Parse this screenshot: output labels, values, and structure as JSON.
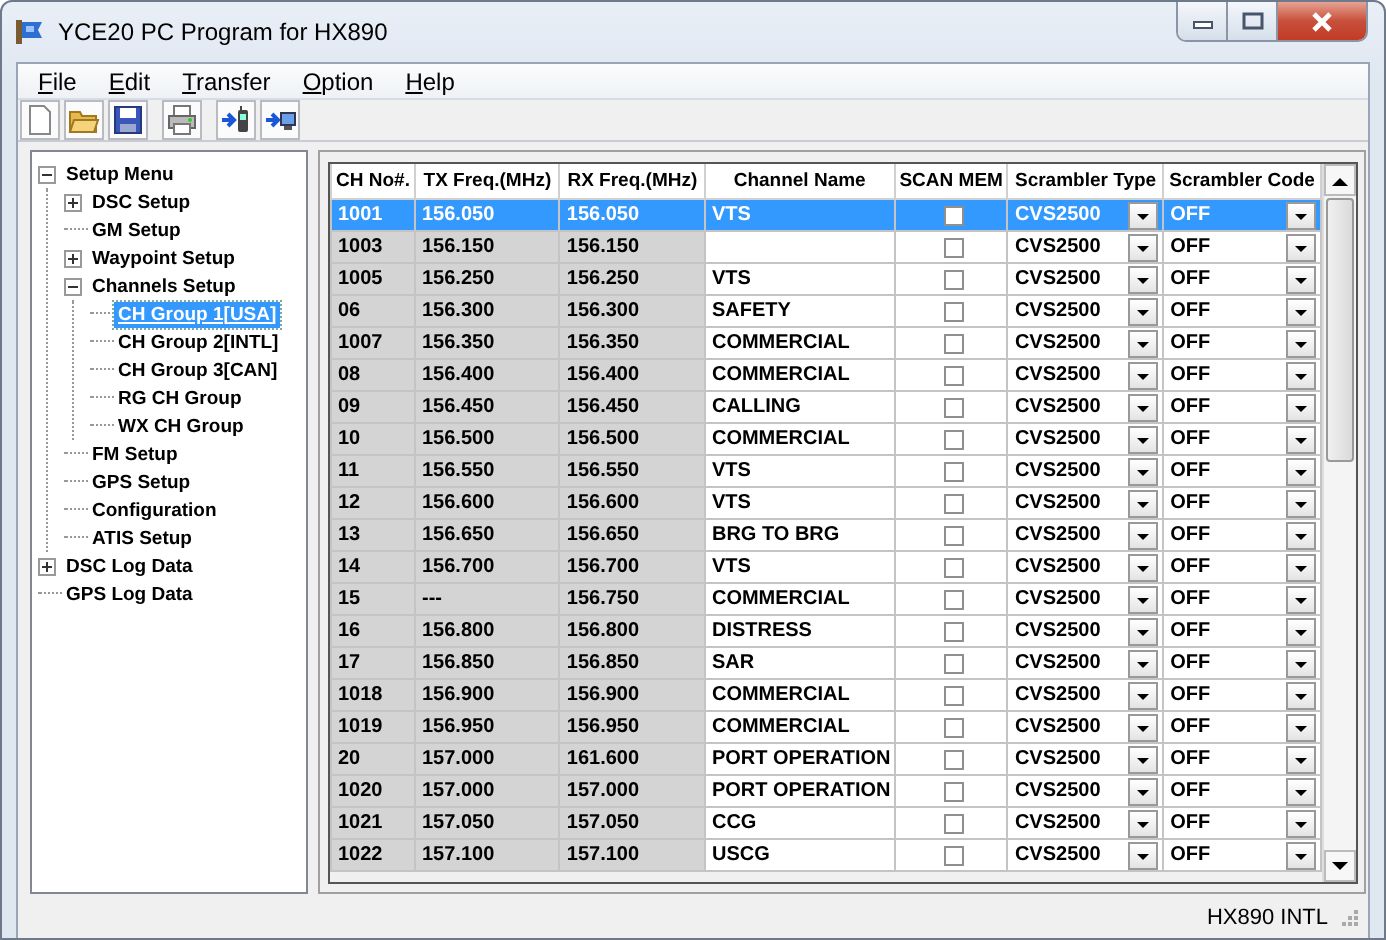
{
  "window": {
    "title": "YCE20 PC Program for HX890"
  },
  "menu": [
    {
      "label": "File"
    },
    {
      "label": "Edit"
    },
    {
      "label": "Transfer"
    },
    {
      "label": "Option"
    },
    {
      "label": "Help"
    }
  ],
  "tree": [
    {
      "label": "Setup Menu",
      "expanded": true,
      "selected": false,
      "children": [
        {
          "label": "DSC Setup",
          "expanded": false,
          "selected": false
        },
        {
          "label": "GM Setup",
          "selected": false
        },
        {
          "label": "Waypoint Setup",
          "expanded": false,
          "selected": false
        },
        {
          "label": "Channels Setup",
          "expanded": true,
          "selected": false,
          "children": [
            {
              "label": "CH Group 1[USA]",
              "selected": true
            },
            {
              "label": "CH Group 2[INTL]",
              "selected": false
            },
            {
              "label": "CH Group 3[CAN]",
              "selected": false
            },
            {
              "label": "RG CH Group",
              "selected": false
            },
            {
              "label": "WX CH Group",
              "selected": false
            }
          ]
        },
        {
          "label": "FM Setup",
          "selected": false
        },
        {
          "label": "GPS Setup",
          "selected": false
        },
        {
          "label": "Configuration",
          "selected": false
        },
        {
          "label": "ATIS Setup",
          "selected": false
        }
      ]
    },
    {
      "label": "DSC Log Data",
      "expanded": false,
      "selected": false
    },
    {
      "label": "GPS Log Data",
      "selected": false
    }
  ],
  "table": {
    "columns": [
      {
        "label": "CH No#.",
        "kind": "readonly"
      },
      {
        "label": "TX Freq.(MHz)",
        "kind": "readonly"
      },
      {
        "label": "RX Freq.(MHz)",
        "kind": "readonly"
      },
      {
        "label": "Channel Name",
        "kind": "text"
      },
      {
        "label": "SCAN MEM",
        "kind": "check"
      },
      {
        "label": "Scrambler Type",
        "kind": "dropdown"
      },
      {
        "label": "Scrambler Code",
        "kind": "dropdown"
      }
    ],
    "rows": [
      {
        "ch": "1001",
        "tx": "156.050",
        "rx": "156.050",
        "name": "VTS",
        "scan": false,
        "type": "CVS2500",
        "code": "OFF",
        "selected": true
      },
      {
        "ch": "1003",
        "tx": "156.150",
        "rx": "156.150",
        "scan": false,
        "type": "CVS2500",
        "code": "OFF",
        "selected": false
      },
      {
        "ch": "1005",
        "tx": "156.250",
        "rx": "156.250",
        "name": "VTS",
        "scan": false,
        "type": "CVS2500",
        "code": "OFF",
        "selected": false
      },
      {
        "ch": "06",
        "tx": "156.300",
        "rx": "156.300",
        "name": "SAFETY",
        "scan": false,
        "type": "CVS2500",
        "code": "OFF",
        "selected": false
      },
      {
        "ch": "1007",
        "tx": "156.350",
        "rx": "156.350",
        "name": "COMMERCIAL",
        "scan": false,
        "type": "CVS2500",
        "code": "OFF",
        "selected": false
      },
      {
        "ch": "08",
        "tx": "156.400",
        "rx": "156.400",
        "name": "COMMERCIAL",
        "scan": false,
        "type": "CVS2500",
        "code": "OFF",
        "selected": false
      },
      {
        "ch": "09",
        "tx": "156.450",
        "rx": "156.450",
        "name": "CALLING",
        "scan": false,
        "type": "CVS2500",
        "code": "OFF",
        "selected": false
      },
      {
        "ch": "10",
        "tx": "156.500",
        "rx": "156.500",
        "name": "COMMERCIAL",
        "scan": false,
        "type": "CVS2500",
        "code": "OFF",
        "selected": false
      },
      {
        "ch": "11",
        "tx": "156.550",
        "rx": "156.550",
        "name": "VTS",
        "scan": false,
        "type": "CVS2500",
        "code": "OFF",
        "selected": false
      },
      {
        "ch": "12",
        "tx": "156.600",
        "rx": "156.600",
        "name": "VTS",
        "scan": false,
        "type": "CVS2500",
        "code": "OFF",
        "selected": false
      },
      {
        "ch": "13",
        "tx": "156.650",
        "rx": "156.650",
        "name": "BRG TO BRG",
        "scan": false,
        "type": "CVS2500",
        "code": "OFF",
        "selected": false
      },
      {
        "ch": "14",
        "tx": "156.700",
        "rx": "156.700",
        "name": "VTS",
        "scan": false,
        "type": "CVS2500",
        "code": "OFF",
        "selected": false
      },
      {
        "ch": "15",
        "tx": "---",
        "rx": "156.750",
        "name": "COMMERCIAL",
        "scan": false,
        "type": "CVS2500",
        "code": "OFF",
        "selected": false
      },
      {
        "ch": "16",
        "tx": "156.800",
        "rx": "156.800",
        "name": "DISTRESS",
        "scan": false,
        "type": "CVS2500",
        "code": "OFF",
        "selected": false
      },
      {
        "ch": "17",
        "tx": "156.850",
        "rx": "156.850",
        "name": "SAR",
        "scan": false,
        "type": "CVS2500",
        "code": "OFF",
        "selected": false
      },
      {
        "ch": "1018",
        "tx": "156.900",
        "rx": "156.900",
        "name": "COMMERCIAL",
        "scan": false,
        "type": "CVS2500",
        "code": "OFF",
        "selected": false
      },
      {
        "ch": "1019",
        "tx": "156.950",
        "rx": "156.950",
        "name": "COMMERCIAL",
        "scan": false,
        "type": "CVS2500",
        "code": "OFF",
        "selected": false
      },
      {
        "ch": "20",
        "tx": "157.000",
        "rx": "161.600",
        "name": "PORT OPERATION",
        "scan": false,
        "type": "CVS2500",
        "code": "OFF",
        "selected": false
      },
      {
        "ch": "1020",
        "tx": "157.000",
        "rx": "157.000",
        "name": "PORT OPERATION",
        "scan": false,
        "type": "CVS2500",
        "code": "OFF",
        "selected": false
      },
      {
        "ch": "1021",
        "tx": "157.050",
        "rx": "157.050",
        "name": "CCG",
        "scan": false,
        "type": "CVS2500",
        "code": "OFF",
        "selected": false
      },
      {
        "ch": "1022",
        "tx": "157.100",
        "rx": "157.100",
        "name": "USCG",
        "scan": false,
        "type": "CVS2500",
        "code": "OFF",
        "selected": false
      }
    ]
  },
  "status_bar": {
    "text": "HX890 INTL"
  }
}
